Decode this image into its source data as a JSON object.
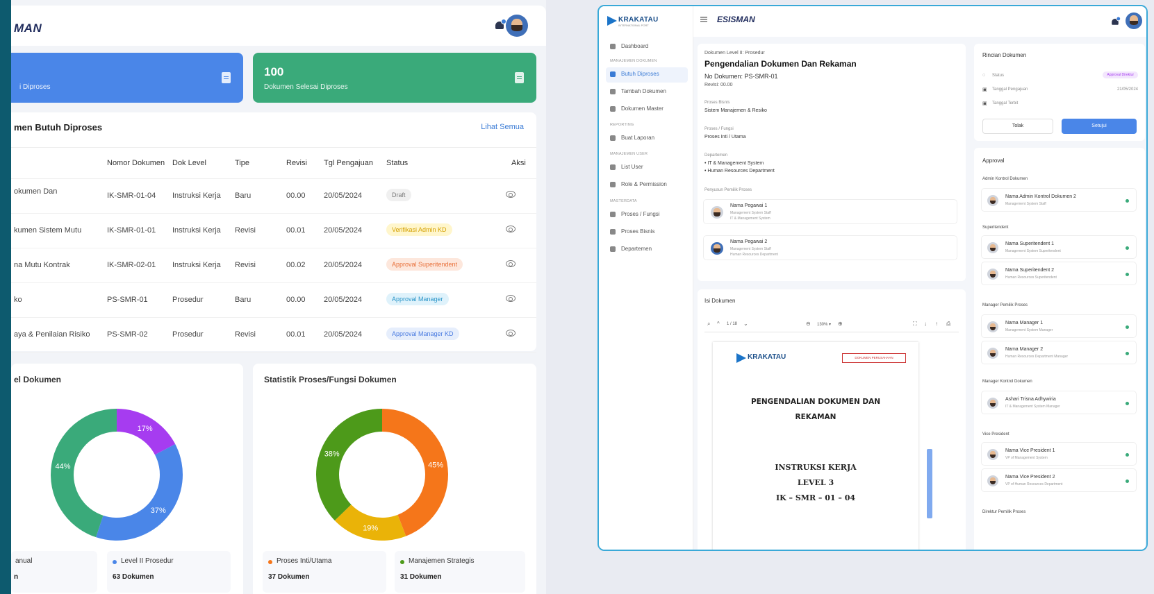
{
  "left": {
    "brand": "MAN",
    "card_blue": {
      "label": "i Diproses"
    },
    "card_green": {
      "number": "100",
      "label": "Dokumen Selesai Diproses"
    },
    "table": {
      "title": "men Butuh Diproses",
      "link": "Lihat Semua",
      "headers": [
        "Nomor Dokumen",
        "Dok Level",
        "Tipe",
        "Revisi",
        "Tgl Pengajuan",
        "Status",
        "Aksi"
      ],
      "rows": [
        {
          "name": "okumen Dan",
          "nomor": "IK-SMR-01-04",
          "level": "Instruksi Kerja",
          "tipe": "Baru",
          "revisi": "00.00",
          "tgl": "20/05/2024",
          "status": "Draft"
        },
        {
          "name": "kumen Sistem Mutu",
          "nomor": "IK-SMR-01-01",
          "level": "Instruksi Kerja",
          "tipe": "Revisi",
          "revisi": "00.01",
          "tgl": "20/05/2024",
          "status": "Verifikasi Admin KD"
        },
        {
          "name": "na Mutu Kontrak",
          "nomor": "IK-SMR-02-01",
          "level": "Instruksi Kerja",
          "tipe": "Revisi",
          "revisi": "00.02",
          "tgl": "20/05/2024",
          "status": "Approval Superitendent"
        },
        {
          "name": "ko",
          "nomor": "PS-SMR-01",
          "level": "Prosedur",
          "tipe": "Baru",
          "revisi": "00.00",
          "tgl": "20/05/2024",
          "status": "Approval Manager"
        },
        {
          "name": "aya & Penilaian Risiko",
          "nomor": "PS-SMR-02",
          "level": "Prosedur",
          "tipe": "Revisi",
          "revisi": "00.01",
          "tgl": "20/05/2024",
          "status": "Approval Manager KD"
        }
      ]
    },
    "chart1": {
      "title": "el Dokumen",
      "legend1_label": "anual",
      "legend1_value": "n",
      "legend2_label": "Level II Prosedur",
      "legend2_value": "63 Dokumen"
    },
    "chart2": {
      "title": "Statistik Proses/Fungsi Dokumen",
      "legend1_label": "Proses Inti/Utama",
      "legend1_value": "37 Dokumen",
      "legend2_label": "Manajemen Strategis",
      "legend2_value": "31 Dokumen"
    }
  },
  "chart_data": [
    {
      "type": "pie",
      "title": "el Dokumen",
      "categories": [
        "",
        "",
        ""
      ],
      "values": [
        17,
        37,
        44
      ],
      "labels": [
        "17%",
        "37%",
        "44%"
      ],
      "colors": [
        "#a63cf0",
        "#4a86e8",
        "#3aaa7a"
      ]
    },
    {
      "type": "pie",
      "title": "Statistik Proses/Fungsi Dokumen",
      "categories": [
        "Proses Inti/Utama",
        "",
        "Manajemen Strategis"
      ],
      "values": [
        45,
        19,
        38
      ],
      "labels": [
        "45%",
        "19%",
        "38%"
      ],
      "colors": [
        "#f5761a",
        "#eab308",
        "#4d9a1a"
      ]
    }
  ],
  "right": {
    "logo": "KRAKATAU",
    "logo_sub": "INTERNATIONAL PORT",
    "brand": "ESISMAN",
    "sidebar": {
      "dashboard": "Dashboard",
      "sec1": "MANAJEMEN DOKUMEN",
      "butuh": "Butuh Diproses",
      "tambah": "Tambah Dokumen",
      "master": "Dokumen Master",
      "sec2": "REPORTING",
      "laporan": "Buat Laporan",
      "sec3": "MANAJEMEN USER",
      "listuser": "List User",
      "role": "Role & Permission",
      "sec4": "MASTERDATA",
      "proses": "Proses / Fungsi",
      "bisnis": "Proses Bisnis",
      "dept": "Departemen"
    },
    "doc": {
      "level": "Dokumen Level II: Prosedur",
      "title": "Pengendalian Dokumen Dan Rekaman",
      "no": "No Dokumen: PS-SMR-01",
      "revisi": "Revisi: 00.00",
      "pb_label": "Proses Bisnis",
      "pb_value": "Sistem Manajemen & Resiko",
      "pf_label": "Proses / Fungsi",
      "pf_value": "Proses Inti / Utama",
      "dept_label": "Departemen",
      "dept1": "• IT & Management System",
      "dept2": "• Human Resources Department",
      "pemilik_label": "Penyusun Pemilik Proses",
      "p1_name": "Nama Pegawai 1",
      "p1_role": "Management System Staff",
      "p1_dept": "IT & Management System",
      "p2_name": "Nama Pegawai 2",
      "p2_role": "Management System Staff",
      "p2_dept": "Human Resources Department"
    },
    "isi": {
      "title": "Isi Dokumen",
      "page": "1 / 18",
      "zoom": "130% ▾",
      "pdf_logo": "KRAKATAU",
      "pdf_stamp": "DOKUMEN PERUSAHAAN",
      "pdf_line1": "PENGENDALIAN DOKUMEN DAN",
      "pdf_line2": "REKAMAN",
      "pdf_line3": "INSTRUKSI KERJA",
      "pdf_line4": "LEVEL 3",
      "pdf_line5": "IK – SMR – 01 – 04"
    },
    "rinci": {
      "title": "Rincian Dokumen",
      "status_label": "Status",
      "status_value": "Approval Direktur",
      "tgl_label": "Tanggal Pengajuan",
      "tgl_value": "21/05/2024",
      "terbit_label": "Tanggal Terbit",
      "tolak": "Tolak",
      "setuju": "Setujui"
    },
    "approval": {
      "title": "Approval",
      "g1": "Admin Kontrol Dokumen",
      "a1n": "Nama Admin Kontrol Dokumen 2",
      "a1r": "Management System Staff",
      "g2": "Superitendent",
      "a2n": "Nama Superitendent 1",
      "a2r": "Management System Superitendent",
      "a3n": "Nama Superitendent 2",
      "a3r": "Human Resources Superitendent",
      "g3": "Manager Pemilik Proses",
      "a4n": "Nama Manager 1",
      "a4r": "Management System Manager",
      "a5n": "Nama Manager 2",
      "a5r": "Human Resources Department Manager",
      "g4": "Manager Kontrol Dokumen",
      "a6n": "Ashari Trisna Adhywiria",
      "a6r": "IT & Management System Manager",
      "g5": "Vice President",
      "a7n": "Nama Vice President 1",
      "a7r": "VP of Management System",
      "a8n": "Nama Vice President 2",
      "a8r": "VP of Human Resources Department",
      "g6": "Direktur Pemilik Proses"
    }
  }
}
